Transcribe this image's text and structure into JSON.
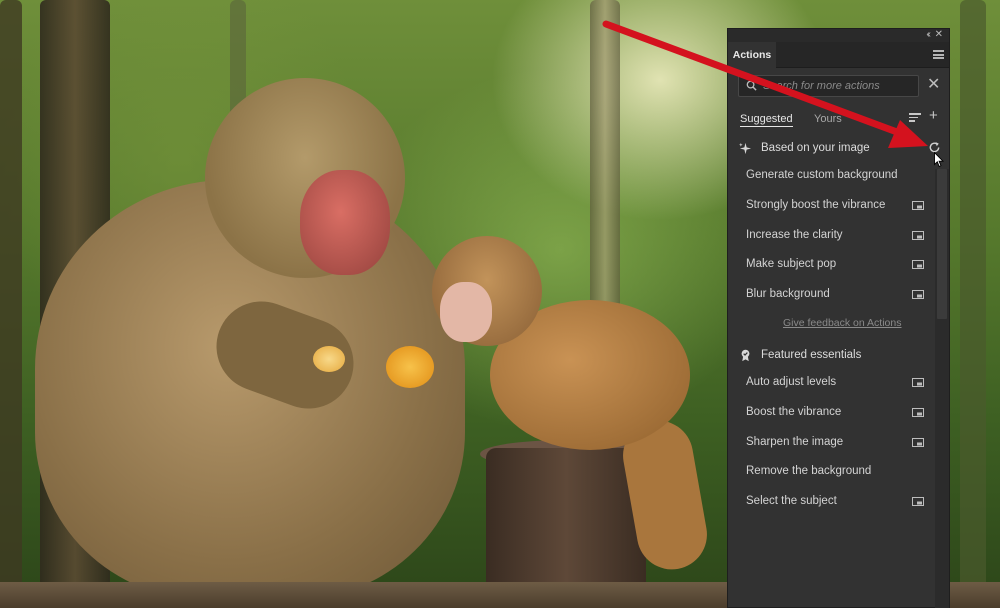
{
  "panel": {
    "tab_label": "Actions",
    "search_placeholder": "Search for more actions",
    "subtabs": {
      "suggested": "Suggested",
      "yours": "Yours"
    },
    "sections": [
      {
        "title": "Based on your image",
        "icon": "sparkle-icon",
        "items": [
          {
            "label": "Generate custom background",
            "preview": false
          },
          {
            "label": "Strongly boost the vibrance",
            "preview": true
          },
          {
            "label": "Increase the clarity",
            "preview": true
          },
          {
            "label": "Make subject pop",
            "preview": true
          },
          {
            "label": "Blur background",
            "preview": true
          }
        ]
      },
      {
        "title": "Featured essentials",
        "icon": "badge-icon",
        "items": [
          {
            "label": "Auto adjust levels",
            "preview": true
          },
          {
            "label": "Boost the vibrance",
            "preview": true
          },
          {
            "label": "Sharpen the image",
            "preview": true
          },
          {
            "label": "Remove the background",
            "preview": false
          },
          {
            "label": "Select the subject",
            "preview": true
          }
        ]
      }
    ],
    "feedback_link": "Give feedback on Actions"
  },
  "colors": {
    "panel_bg": "#323232",
    "arrow_red": "#d4121e"
  }
}
